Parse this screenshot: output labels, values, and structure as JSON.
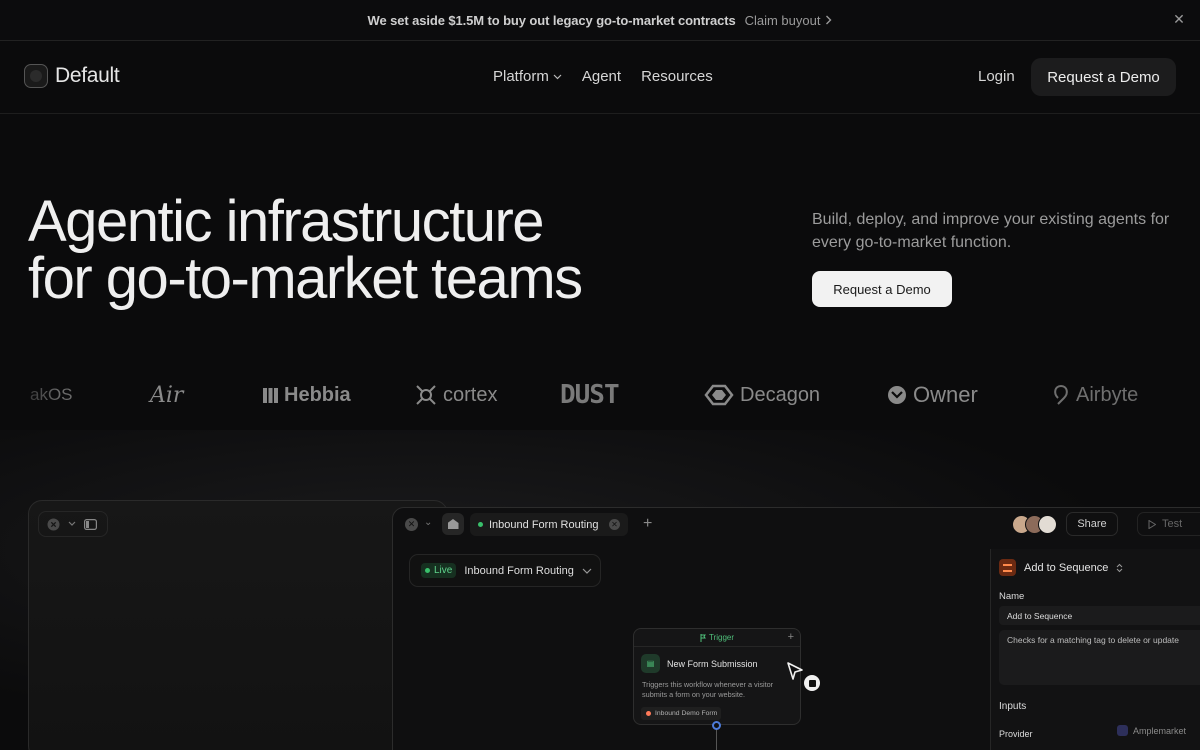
{
  "banner": {
    "message": "We set aside $1.5M to buy out legacy go-to-market contracts",
    "link_label": "Claim buyout",
    "close_glyph": "✕"
  },
  "nav": {
    "brand": "Default",
    "menu": [
      {
        "label": "Platform",
        "has_dropdown": true
      },
      {
        "label": "Agent",
        "has_dropdown": false
      },
      {
        "label": "Resources",
        "has_dropdown": false
      }
    ],
    "login_label": "Login",
    "demo_label": "Request a Demo"
  },
  "hero": {
    "title_line1": "Agentic infrastructure",
    "title_line2": "for go-to-market teams",
    "subtitle": "Build, deploy, and improve your existing agents for every go-to-market function.",
    "cta_label": "Request a Demo"
  },
  "logos": [
    "akOS",
    "Air",
    "Hebbia",
    "cortex",
    "DUST",
    "Decagon",
    "Owner",
    "Airbyte"
  ],
  "app": {
    "tab_label": "Inbound Form Routing",
    "share_label": "Share",
    "test_label": "Test",
    "workflow_status": "Live",
    "workflow_name": "Inbound Form Routing",
    "node": {
      "header": "Trigger",
      "title": "New Form Submission",
      "description": "Triggers this workflow whenever a visitor submits a form on your website.",
      "chip": "Inbound Demo Form"
    },
    "panel": {
      "title": "Add to Sequence",
      "name_label": "Name",
      "name_value": "Add to Sequence",
      "description": "Checks for a matching tag to delete or update",
      "inputs_label": "Inputs",
      "provider_label": "Provider",
      "provider_value": "Amplemarket"
    }
  },
  "colors": {
    "background": "#0b0b0c",
    "live_green": "#39c06b",
    "cta_light": "#f2f2f2",
    "sequence_orange": "#ff8a4c"
  }
}
